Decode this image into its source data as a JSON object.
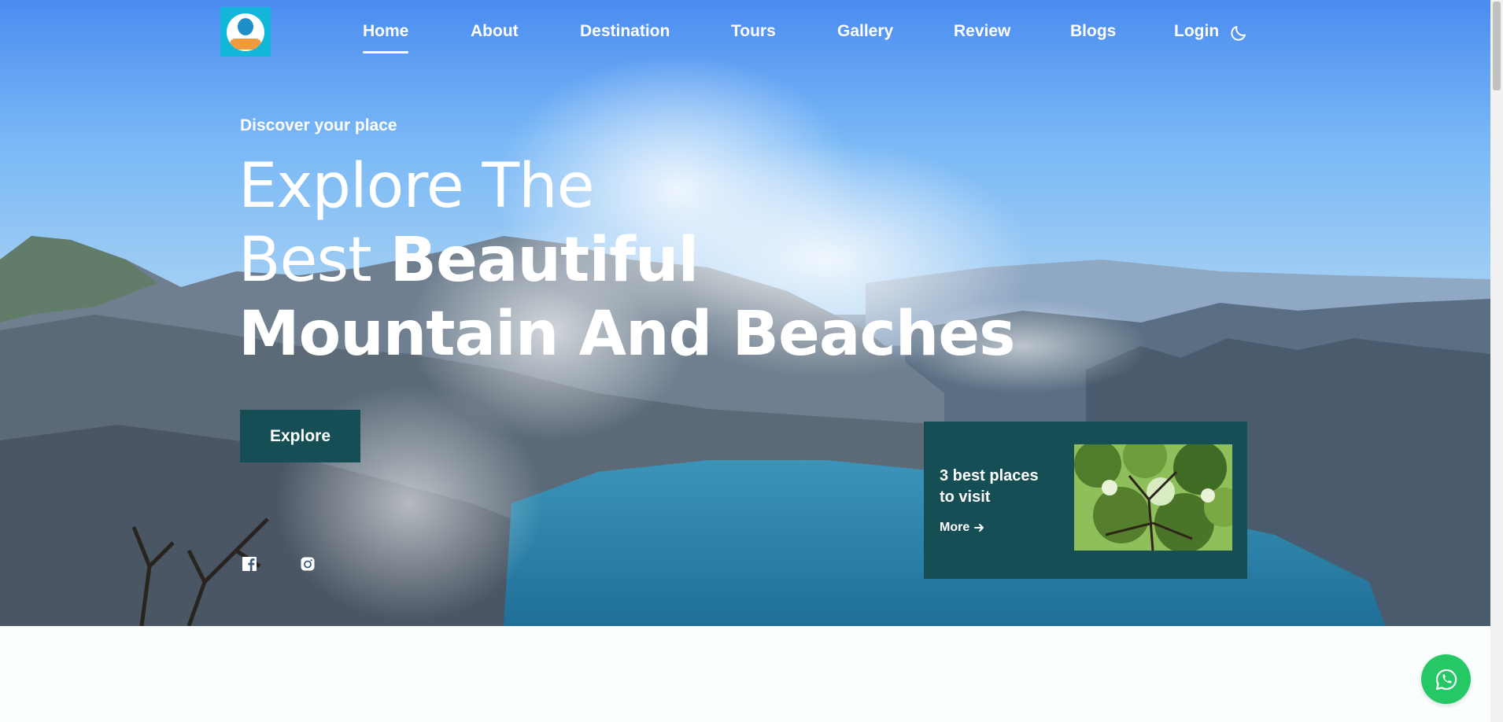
{
  "nav": {
    "items": [
      {
        "label": "Home",
        "active": true
      },
      {
        "label": "About"
      },
      {
        "label": "Destination"
      },
      {
        "label": "Tours"
      },
      {
        "label": "Gallery"
      },
      {
        "label": "Review"
      },
      {
        "label": "Blogs"
      },
      {
        "label": "Login"
      }
    ],
    "theme_toggle_icon": "moon-icon"
  },
  "hero": {
    "eyebrow": "Discover your place",
    "headline": {
      "line1": "Explore The",
      "line2_light": "Best ",
      "line2_bold": "Beautiful",
      "line3": "Mountain And Beaches"
    },
    "cta_label": "Explore",
    "social_icons": [
      "facebook-icon",
      "instagram-icon"
    ]
  },
  "card": {
    "title": "3 best places to visit",
    "more_label": "More"
  },
  "colors": {
    "accent": "#154f55",
    "whatsapp": "#25c864"
  }
}
